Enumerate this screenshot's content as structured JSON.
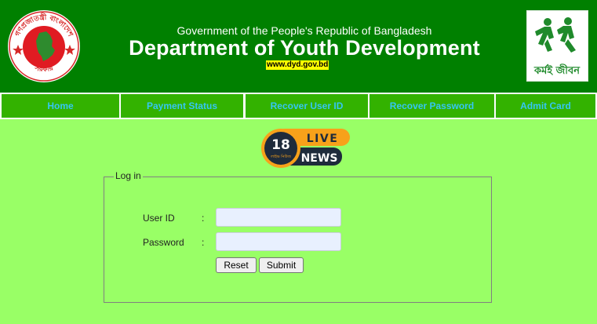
{
  "header": {
    "gov_line": "Government of the People's Republic of Bangladesh",
    "title": "Department of Youth Development",
    "url": "www.dyd.gov.bd",
    "seal_icon": "bangladesh-government-seal-icon",
    "logo_icon": "karmai-jibon-logo-icon",
    "logo_text": "কর্মই জীবন",
    "colors": {
      "header_bg": "#008000",
      "nav_bg": "#33b200",
      "nav_text": "#34c6f4",
      "page_bg": "#99ff66",
      "url_highlight": "#ffff00"
    }
  },
  "nav": {
    "items": [
      {
        "label": "Home"
      },
      {
        "label": "Payment Status"
      },
      {
        "label": "Recover User ID"
      },
      {
        "label": "Recover Password"
      },
      {
        "label": "Admit Card"
      }
    ]
  },
  "badge": {
    "number": "18",
    "live": "LIVE",
    "news": "NEWS",
    "sub": "লাইভ নিউজ",
    "icon": "18-live-news-badge-icon"
  },
  "login": {
    "legend": "Log in",
    "user_id_label": "User ID",
    "password_label": "Password",
    "colon": ":",
    "user_id_value": "",
    "password_value": "",
    "reset_label": "Reset",
    "submit_label": "Submit"
  }
}
